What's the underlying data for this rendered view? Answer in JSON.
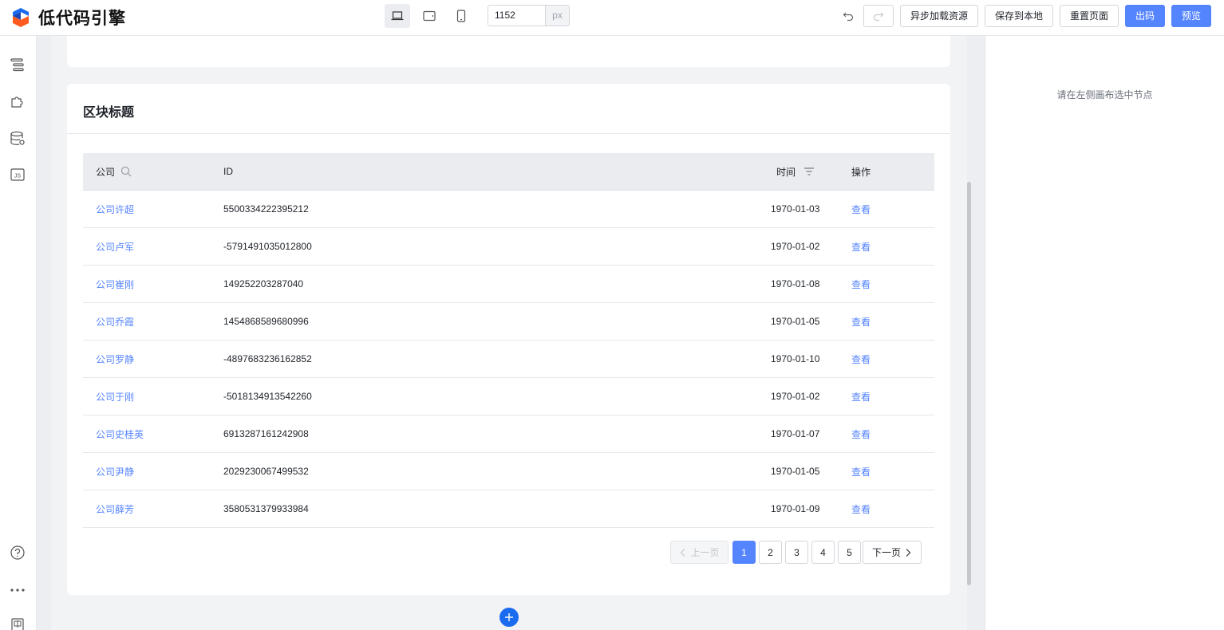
{
  "app": {
    "logo_text": "低代码引擎"
  },
  "toolbar": {
    "devices": [
      {
        "name": "desktop",
        "icon": "laptop-icon",
        "active": true
      },
      {
        "name": "tablet",
        "icon": "tablet-icon",
        "active": false
      },
      {
        "name": "phone",
        "icon": "phone-icon",
        "active": false
      }
    ],
    "width_value": "1152",
    "width_unit": "px",
    "undo_icon": "undo-icon",
    "redo_icon": "redo-icon",
    "buttons": {
      "async_load": "异步加载资源",
      "save_local": "保存到本地",
      "reset_page": "重置页面",
      "export_code": "出码",
      "preview": "预览"
    },
    "accent_color": "#5584ff"
  },
  "left_rail": {
    "icons": [
      "outline-tree-icon",
      "component-puzzle-icon",
      "datasource-database-icon",
      "js-code-icon",
      "help-icon",
      "more-icon",
      "language-icon"
    ]
  },
  "right_panel": {
    "hint": "请在左侧画布选中节点"
  },
  "card": {
    "title": "区块标题",
    "table": {
      "columns": {
        "company": "公司",
        "id": "ID",
        "time": "时间",
        "action": "操作"
      },
      "rows": [
        {
          "company": "公司许超",
          "id": "5500334222395212",
          "time": "1970-01-03",
          "action": "查看"
        },
        {
          "company": "公司卢军",
          "id": "-5791491035012800",
          "time": "1970-01-02",
          "action": "查看"
        },
        {
          "company": "公司崔刚",
          "id": "149252203287040",
          "time": "1970-01-08",
          "action": "查看"
        },
        {
          "company": "公司乔霞",
          "id": "1454868589680996",
          "time": "1970-01-05",
          "action": "查看"
        },
        {
          "company": "公司罗静",
          "id": "-4897683236162852",
          "time": "1970-01-10",
          "action": "查看"
        },
        {
          "company": "公司于刚",
          "id": "-5018134913542260",
          "time": "1970-01-02",
          "action": "查看"
        },
        {
          "company": "公司史桂英",
          "id": "6913287161242908",
          "time": "1970-01-07",
          "action": "查看"
        },
        {
          "company": "公司尹静",
          "id": "2029230067499532",
          "time": "1970-01-05",
          "action": "查看"
        },
        {
          "company": "公司薛芳",
          "id": "3580531379933984",
          "time": "1970-01-09",
          "action": "查看"
        }
      ]
    },
    "pagination": {
      "prev": "上一页",
      "next": "下一页",
      "pages": [
        "1",
        "2",
        "3",
        "4",
        "5"
      ],
      "current": "1"
    }
  }
}
